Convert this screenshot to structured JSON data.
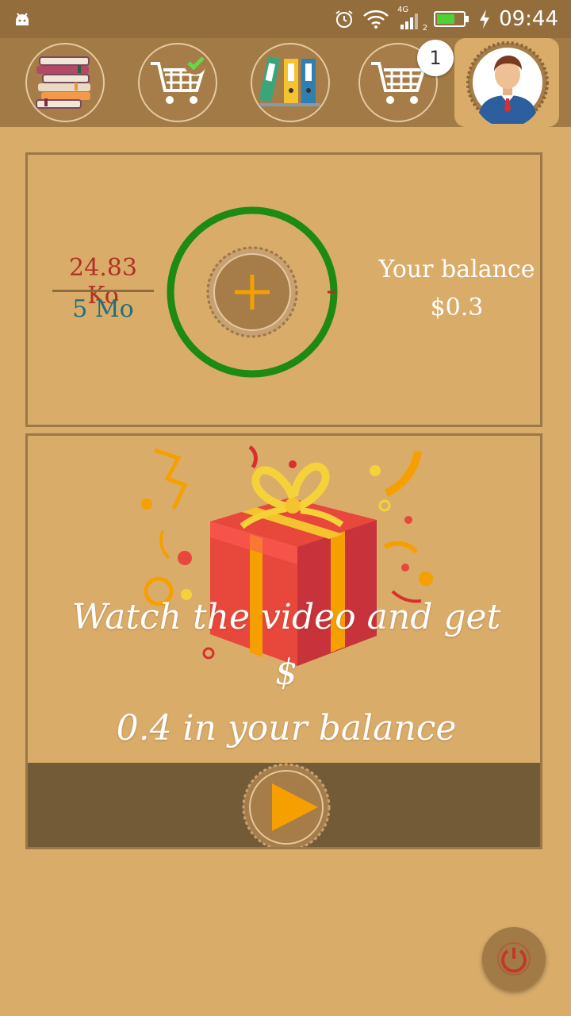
{
  "status_bar": {
    "time": "09:44",
    "network": "4G",
    "sim": "2",
    "icons": [
      "android-icon",
      "alarm-icon",
      "wifi-icon",
      "signal-icon",
      "battery-icon",
      "charging-icon"
    ]
  },
  "toolbar": {
    "items": [
      {
        "name": "books",
        "icon": "books-icon"
      },
      {
        "name": "cart-done",
        "icon": "cart-check-icon"
      },
      {
        "name": "folders",
        "icon": "folders-icon"
      },
      {
        "name": "cart",
        "icon": "cart-icon",
        "badge": "1"
      },
      {
        "name": "profile",
        "icon": "avatar-icon",
        "selected": true
      }
    ]
  },
  "usage": {
    "used": "24.83 Ko",
    "total": "5 Mo",
    "progress_fraction": 0.005
  },
  "balance": {
    "label": "Your balance",
    "value": "$0.3"
  },
  "gift": {
    "text_line1": "Watch the video and get $",
    "text_line2": "0.4 in your balance"
  },
  "colors": {
    "background": "#d9ac6a",
    "toolbar": "#a17a45",
    "ring": "#1c8a14",
    "accent": "#f5a000",
    "used_text": "#b03224",
    "total_text": "#23707a"
  }
}
